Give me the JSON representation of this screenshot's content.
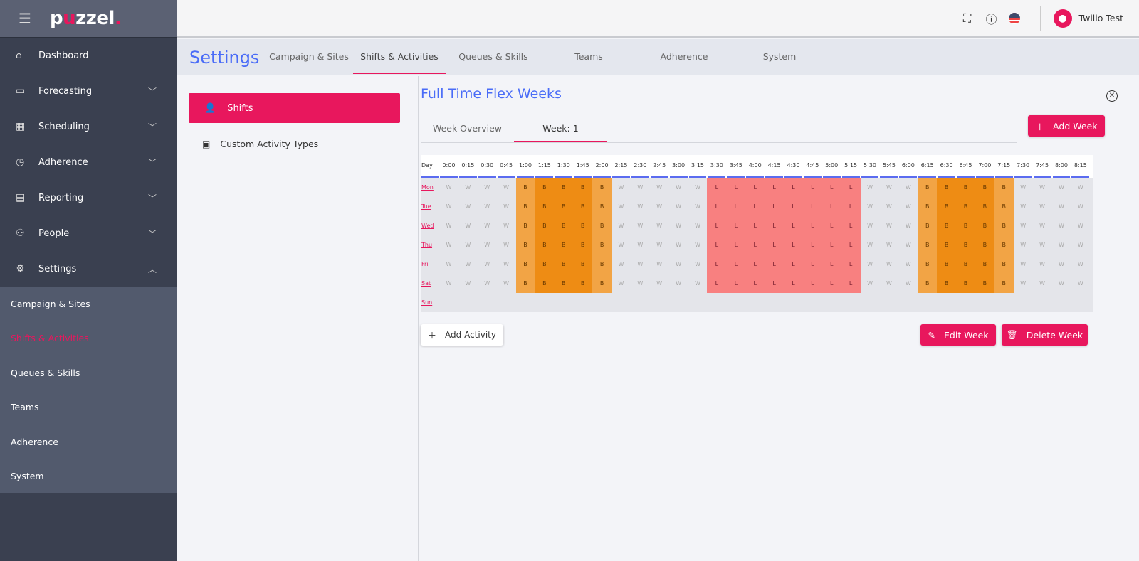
{
  "brand": {
    "logo": "puzzel."
  },
  "sidebar": {
    "items": [
      {
        "label": "Dashboard",
        "icon": "home-icon",
        "chevron": ""
      },
      {
        "label": "Forecasting",
        "icon": "forecast-icon",
        "chevron": "down"
      },
      {
        "label": "Scheduling",
        "icon": "calendar-icon",
        "chevron": "down"
      },
      {
        "label": "Adherence",
        "icon": "watch-icon",
        "chevron": "down"
      },
      {
        "label": "Reporting",
        "icon": "report-icon",
        "chevron": "down"
      },
      {
        "label": "People",
        "icon": "people-icon",
        "chevron": "down"
      },
      {
        "label": "Settings",
        "icon": "gear-icon",
        "chevron": "up"
      }
    ],
    "submenu": [
      "Campaign & Sites",
      "Shifts & Activities",
      "Queues & Skills",
      "Teams",
      "Adherence",
      "System"
    ],
    "submenu_active": 1
  },
  "topbar": {
    "user": "Twilio Test"
  },
  "settings": {
    "title": "Settings",
    "tabs": [
      "Campaign & Sites",
      "Shifts & Activities",
      "Queues & Skills",
      "Teams",
      "Adherence",
      "System"
    ],
    "active_tab": 1
  },
  "left_panel": {
    "shifts": "Shifts",
    "custom_activity_types": "Custom Activity Types"
  },
  "main": {
    "title": "Full Time Flex Weeks",
    "week_tabs": [
      "Week Overview",
      "Week: 1"
    ],
    "active_week_tab": 1,
    "add_week": "Add Week",
    "add_activity": "Add Activity",
    "edit_week": "Edit Week",
    "delete_week": "Delete Week"
  },
  "grid": {
    "day_header": "Day",
    "times": [
      "0:00",
      "0:15",
      "0:30",
      "0:45",
      "1:00",
      "1:15",
      "1:30",
      "1:45",
      "2:00",
      "2:15",
      "2:30",
      "2:45",
      "3:00",
      "3:15",
      "3:30",
      "3:45",
      "4:00",
      "4:15",
      "4:30",
      "4:45",
      "5:00",
      "5:15",
      "5:30",
      "5:45",
      "6:00",
      "6:15",
      "6:30",
      "6:45",
      "7:00",
      "7:15",
      "7:30",
      "7:45",
      "8:00",
      "8:15"
    ],
    "rows": [
      {
        "day": "Mon",
        "cells": "WWWWBBBBBWWWWWLLLLLLLLWWWBBBBBWWWW"
      },
      {
        "day": "Tue",
        "cells": "WWWWBBBBBWWWWWLLLLLLLLWWWBBBBBWWWW"
      },
      {
        "day": "Wed",
        "cells": "WWWWBBBBBWWWWWLLLLLLLLWWWBBBBBWWWW"
      },
      {
        "day": "Thu",
        "cells": "WWWWBBBBBWWWWWLLLLLLLLWWWBBBBBWWWW"
      },
      {
        "day": "Fri",
        "cells": "WWWWBBBBBWWWWWLLLLLLLLWWWBBBBBWWWW"
      },
      {
        "day": "Sat",
        "cells": "WWWWBBBBBWWWWWLLLLLLLLWWWBBBBBWWWW"
      },
      {
        "day": "Sun",
        "cells": ""
      }
    ]
  },
  "colors": {
    "accent": "#e8175d",
    "title_blue": "#4a6cf7",
    "break": "#ee8c14",
    "lunch": "#f88080",
    "work": "#e4e5ea"
  }
}
